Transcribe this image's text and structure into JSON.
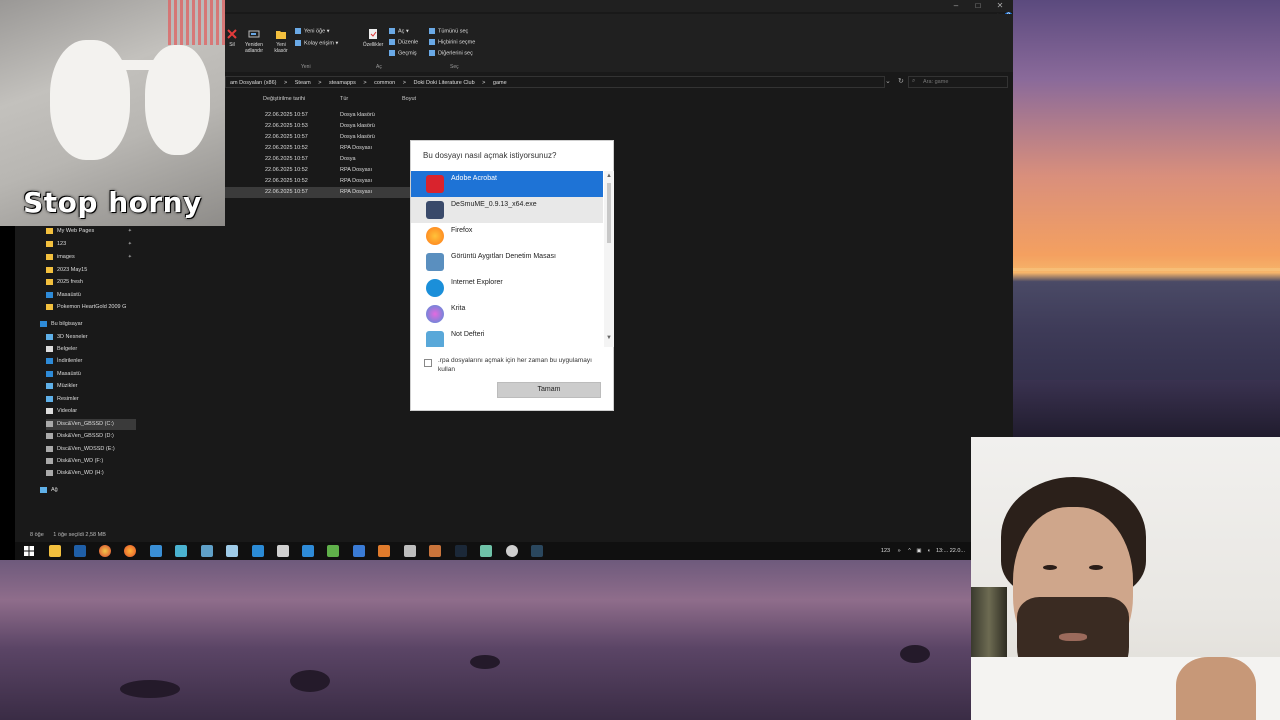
{
  "colors": {
    "accent": "#1e73d6",
    "explorer_bg": "#191919",
    "taskbar": "#101010"
  },
  "gif": {
    "caption": "Stop horny"
  },
  "window": {
    "controls": [
      "–",
      "□",
      "✕"
    ]
  },
  "ribbon": {
    "buttons": [
      {
        "label": "Sil",
        "icon": "delete-icon"
      },
      {
        "label": "Yeniden adlandır",
        "icon": "rename-icon"
      },
      {
        "label": "Yeni klasör",
        "icon": "new-folder-icon"
      },
      {
        "label": "Özellikler",
        "icon": "properties-icon"
      }
    ],
    "small": {
      "new_item": "Yeni öğe",
      "easy_access": "Kolay erişim",
      "open": "Aç",
      "edit": "Düzenle",
      "history": "Geçmiş",
      "select_all": "Tümünü seç",
      "select_none": "Hiçbirini seçme",
      "invert_selection": "Diğerlerini seç"
    },
    "groups": {
      "new": "Yeni",
      "open": "Aç",
      "select": "Seç"
    }
  },
  "address": {
    "crumbs": [
      "am Dosyaları (x86)",
      ">",
      "Steam",
      ">",
      "steamapps",
      ">",
      "common",
      ">",
      "Doki Doki Literature Club",
      ">",
      "game"
    ],
    "search_placeholder": "Ara: game"
  },
  "columns": {
    "modified": "Değiştirilme tarihi",
    "type": "Tür",
    "size": "Boyut"
  },
  "files": [
    {
      "date": "22.06.2025 10:57",
      "type": "Dosya klasörü"
    },
    {
      "date": "22.06.2025 10:53",
      "type": "Dosya klasörü"
    },
    {
      "date": "22.06.2025 10:57",
      "type": "Dosya klasörü"
    },
    {
      "date": "22.06.2025 10:52",
      "type": "RPA Dosyası"
    },
    {
      "date": "22.06.2025 10:57",
      "type": "Dosya"
    },
    {
      "date": "22.06.2025 10:52",
      "type": "RPA Dosyası"
    },
    {
      "date": "22.06.2025 10:52",
      "type": "RPA Dosyası"
    },
    {
      "date": "22.06.2025 10:57",
      "type": "RPA Dosyası"
    }
  ],
  "sidebar": [
    {
      "label": "My Web Pages",
      "pinned": true
    },
    {
      "label": "123",
      "pinned": true
    },
    {
      "label": "images",
      "pinned": true
    },
    {
      "label": "2023 May15",
      "pinned": false
    },
    {
      "label": "2025 fresh",
      "pinned": false
    },
    {
      "label": "Masaüstü",
      "pinned": false
    },
    {
      "label": "Pokemon HeartGold 2009 G",
      "pinned": false
    },
    {
      "label": "Bu bilgisayar",
      "pinned": false
    },
    {
      "label": "3D Nesneler",
      "pinned": false
    },
    {
      "label": "Belgeler",
      "pinned": false
    },
    {
      "label": "İndirilenler",
      "pinned": false
    },
    {
      "label": "Masaüstü",
      "pinned": false
    },
    {
      "label": "Müzikler",
      "pinned": false
    },
    {
      "label": "Resimler",
      "pinned": false
    },
    {
      "label": "Videolar",
      "pinned": false
    },
    {
      "label": "Disc&Ven_GBSSD (C:)",
      "pinned": false
    },
    {
      "label": "Disk&Ven_GBSSD (D:)",
      "pinned": false
    },
    {
      "label": "Disc&Ven_WDSSD (E:)",
      "pinned": false
    },
    {
      "label": "Disk&Ven_WD (F:)",
      "pinned": false
    },
    {
      "label": "Disk&Ven_WD (H:)",
      "pinned": false
    },
    {
      "label": "Ağ",
      "pinned": false
    }
  ],
  "status": {
    "items": "8 öğe",
    "selected": "1 öğe seçildi  2,58 MB"
  },
  "dialog": {
    "title": "Bu dosyayı nasıl açmak istiyorsunuz?",
    "apps": [
      {
        "name": "Adobe Acrobat",
        "icon": "adobe-acrobat-icon",
        "color": "#d9232d"
      },
      {
        "name": "DeSmuME_0.9.13_x64.exe",
        "icon": "desmume-icon",
        "color": "#3a4a6a"
      },
      {
        "name": "Firefox",
        "icon": "firefox-icon",
        "color": "#ff7a1a"
      },
      {
        "name": "Görüntü Aygıtları Denetim Masası",
        "icon": "imaging-devices-icon",
        "color": "#5a8fbf"
      },
      {
        "name": "Internet Explorer",
        "icon": "internet-explorer-icon",
        "color": "#1b8fd9"
      },
      {
        "name": "Krita",
        "icon": "krita-icon",
        "color": "#4a8fd6"
      },
      {
        "name": "Not Defteri",
        "icon": "notepad-icon",
        "color": "#59a8d9"
      }
    ],
    "always_label": ".rpa dosyalarını açmak için her zaman bu uygulamayı kullan",
    "ok": "Tamam"
  },
  "taskbar": {
    "tray_text": "123",
    "time": "13:...",
    "date": "22.0..."
  }
}
